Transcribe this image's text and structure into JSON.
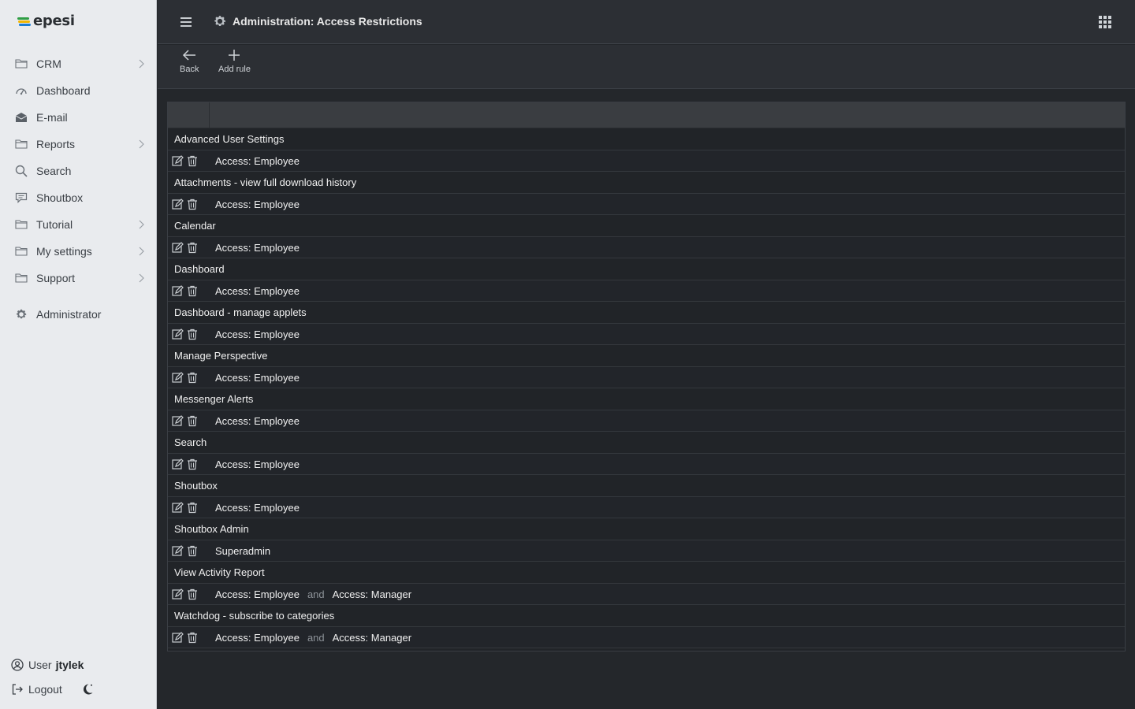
{
  "app": {
    "logo_text": "epesi"
  },
  "sidebar": {
    "items": [
      {
        "label": "CRM",
        "icon": "folder-icon",
        "has_submenu": true
      },
      {
        "label": "Dashboard",
        "icon": "dashboard-icon",
        "has_submenu": false
      },
      {
        "label": "E-mail",
        "icon": "envelope-icon",
        "has_submenu": false
      },
      {
        "label": "Reports",
        "icon": "folder-icon",
        "has_submenu": true
      },
      {
        "label": "Search",
        "icon": "search-icon",
        "has_submenu": false
      },
      {
        "label": "Shoutbox",
        "icon": "chat-icon",
        "has_submenu": false
      },
      {
        "label": "Tutorial",
        "icon": "folder-icon",
        "has_submenu": true
      },
      {
        "label": "My settings",
        "icon": "folder-icon",
        "has_submenu": true
      },
      {
        "label": "Support",
        "icon": "folder-icon",
        "has_submenu": true
      }
    ],
    "admin": {
      "label": "Administrator",
      "icon": "gear-icon"
    },
    "user": {
      "prefix": "User",
      "name": "jtylek"
    },
    "logout_label": "Logout"
  },
  "header": {
    "title": "Administration: Access Restrictions"
  },
  "toolbar": {
    "back_label": "Back",
    "add_rule_label": "Add rule"
  },
  "table": {
    "groups": [
      {
        "name": "Advanced User Settings",
        "rules": [
          [
            "Access: Employee"
          ]
        ]
      },
      {
        "name": "Attachments - view full download history",
        "rules": [
          [
            "Access: Employee"
          ]
        ]
      },
      {
        "name": "Calendar",
        "rules": [
          [
            "Access: Employee"
          ]
        ]
      },
      {
        "name": "Dashboard",
        "rules": [
          [
            "Access: Employee"
          ]
        ]
      },
      {
        "name": "Dashboard - manage applets",
        "rules": [
          [
            "Access: Employee"
          ]
        ]
      },
      {
        "name": "Manage Perspective",
        "rules": [
          [
            "Access: Employee"
          ]
        ]
      },
      {
        "name": "Messenger Alerts",
        "rules": [
          [
            "Access: Employee"
          ]
        ]
      },
      {
        "name": "Search",
        "rules": [
          [
            "Access: Employee"
          ]
        ]
      },
      {
        "name": "Shoutbox",
        "rules": [
          [
            "Access: Employee"
          ]
        ]
      },
      {
        "name": "Shoutbox Admin",
        "rules": [
          [
            "Superadmin"
          ]
        ]
      },
      {
        "name": "View Activity Report",
        "rules": [
          [
            "Access: Employee",
            "Access: Manager"
          ]
        ]
      },
      {
        "name": "Watchdog - subscribe to categories",
        "rules": [
          [
            "Access: Employee",
            "Access: Manager"
          ]
        ]
      }
    ],
    "conjunction": "and"
  },
  "colors": {
    "background": "#24272b",
    "sidebar": "#e9ebee",
    "topbar": "#2c2f34",
    "table_header": "#3a3d41"
  }
}
